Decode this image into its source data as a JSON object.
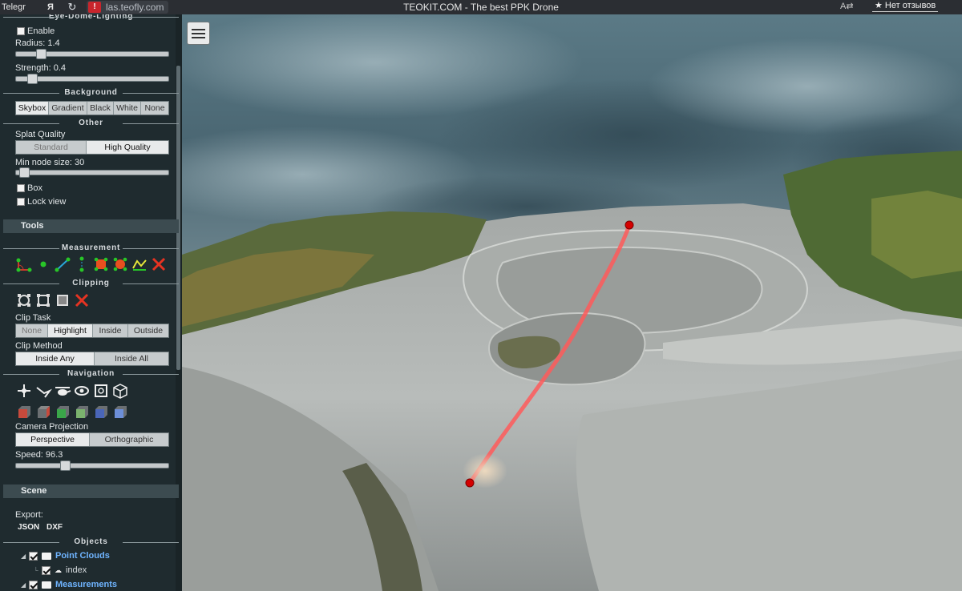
{
  "browser": {
    "tab_partial": "Telegr",
    "yandex": "Я",
    "reload": "↻",
    "url": "las.teofly.com",
    "page_title": "TEOKIT.COM - The best PPK Drone",
    "reviews_label": "★ Нет отзывов",
    "translate_icon": "translate-icon"
  },
  "sidebar": {
    "edl": {
      "title": "Eye-Dome-Lighting",
      "enable_label": "Enable",
      "radius_label": "Radius: 1.4",
      "radius_fraction": 0.14,
      "strength_label": "Strength: 0.4",
      "strength_fraction": 0.08
    },
    "background": {
      "title": "Background",
      "options": [
        "Skybox",
        "Gradient",
        "Black",
        "White",
        "None"
      ],
      "selected": "Skybox"
    },
    "other": {
      "title": "Other",
      "splat_label": "Splat Quality",
      "splat_options": [
        "Standard",
        "High Quality"
      ],
      "splat_selected": "High Quality",
      "min_node_label": "Min node size: 30",
      "min_node_fraction": 0.02,
      "box_label": "Box",
      "lock_label": "Lock view"
    },
    "tools_header": "Tools",
    "measurement": {
      "title": "Measurement"
    },
    "clipping": {
      "title": "Clipping",
      "clip_task_label": "Clip Task",
      "clip_task_options": [
        "None",
        "Highlight",
        "Inside",
        "Outside"
      ],
      "clip_task_selected": "Highlight",
      "clip_method_label": "Clip Method",
      "clip_method_options": [
        "Inside Any",
        "Inside All"
      ],
      "clip_method_selected": "Inside Any"
    },
    "navigation": {
      "title": "Navigation",
      "camera_label": "Camera Projection",
      "camera_options": [
        "Perspective",
        "Orthographic"
      ],
      "camera_selected": "Perspective",
      "speed_label": "Speed: 96.3",
      "speed_fraction": 0.31
    },
    "scene_header": "Scene",
    "export": {
      "label": "Export:",
      "json": "JSON",
      "dxf": "DXF"
    },
    "objects": {
      "title": "Objects",
      "point_clouds": "Point Clouds",
      "index": "index",
      "measurements": "Measurements"
    }
  },
  "colors": {
    "sidebar_bg": "#1f2b2f",
    "measure_line": "#ff5a5a",
    "measure_point": "#d40000",
    "link_blue": "#6fb4ff"
  }
}
